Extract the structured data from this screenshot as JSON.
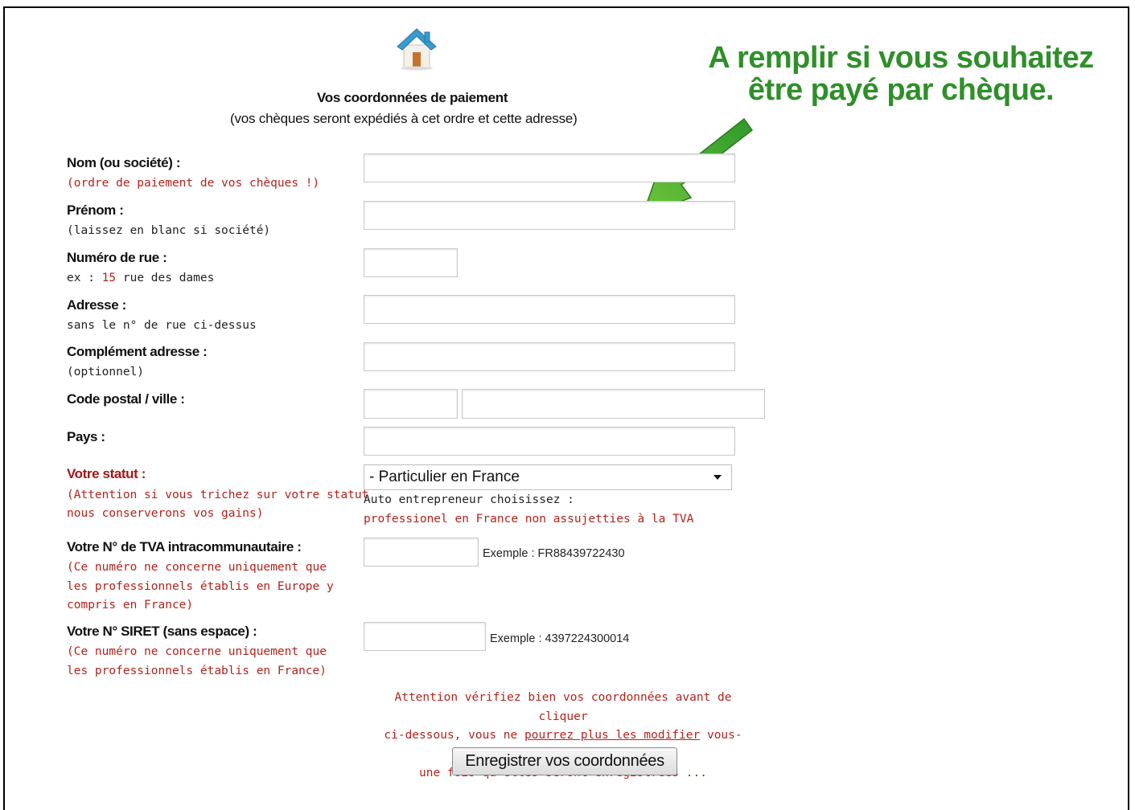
{
  "header": {
    "icon": "home-icon",
    "title": "Vos coordonnées de paiement",
    "subtitle": "(vos chèques seront expédiés à cet ordre et cette adresse)"
  },
  "annotation": {
    "line1": "A remplir si vous souhaitez",
    "line2": "être payé par chèque.",
    "color": "#2f8f2a",
    "icon": "green-arrow-icon"
  },
  "form": {
    "nom": {
      "label": "Nom (ou société) :",
      "hint": "(ordre de paiement de vos chèques !)",
      "value": ""
    },
    "prenom": {
      "label": "Prénom :",
      "hint": "(laissez en blanc si société)",
      "value": ""
    },
    "numero": {
      "label": "Numéro de rue :",
      "hint_prefix": "ex : ",
      "hint_num": "15",
      "hint_suffix": " rue des dames",
      "value": ""
    },
    "adresse": {
      "label": "Adresse :",
      "hint": "sans le n° de rue ci-dessus",
      "value": ""
    },
    "complement": {
      "label": "Complément adresse :",
      "hint": "(optionnel)",
      "value": ""
    },
    "codepostal": {
      "label": "Code postal / ville :",
      "postal_value": "",
      "ville_value": ""
    },
    "pays": {
      "label": "Pays :",
      "value": ""
    },
    "statut": {
      "label": "Votre statut :",
      "hint_line1": "(Attention si vous trichez sur votre statut",
      "hint_line2": "nous conserverons vos gains)",
      "selected": "- Particulier en France",
      "note1": "Auto entrepreneur choisissez :",
      "note2": "professionel en France non assujetties à la TVA"
    },
    "tva": {
      "label": "Votre N° de TVA intracommunautaire :",
      "hint_line1": "(Ce numéro ne concerne uniquement que",
      "hint_line2": "les professionnels établis en Europe y",
      "hint_line3": "compris en France)",
      "example": "Exemple : FR88439722430",
      "value": ""
    },
    "siret": {
      "label": "Votre N° SIRET (sans espace) :",
      "hint_line1": "(Ce numéro ne concerne uniquement que",
      "hint_line2": "les professionnels établis en France)",
      "example": "Exemple : 4397224300014",
      "value": ""
    }
  },
  "footer": {
    "warning_line1": "Attention vérifiez bien vos coordonnées avant de cliquer",
    "warning_line2_prefix": "ci-dessous, vous ne ",
    "warning_link": "pourrez plus les modifier",
    "warning_line2_suffix": " vous-même",
    "warning_line3": "une fois qu'elles seront enregistrées ...",
    "submit_label": "Enregistrer vos coordonnées"
  }
}
